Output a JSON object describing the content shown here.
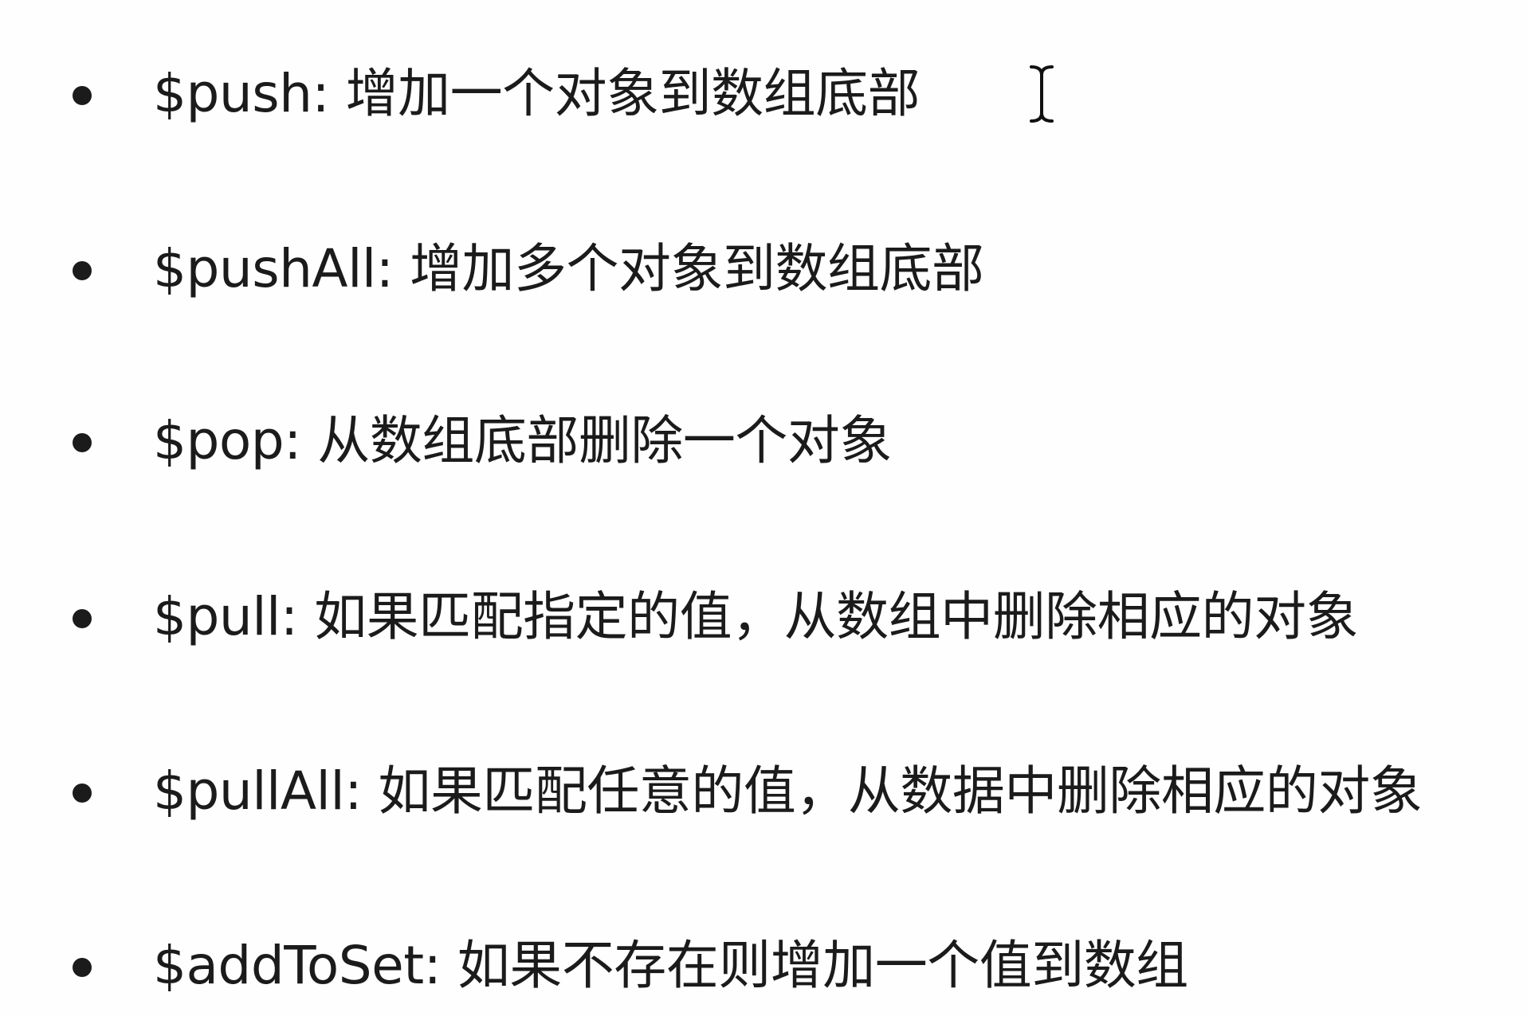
{
  "items": [
    {
      "text": "$push: 增加一个对象到数组底部"
    },
    {
      "text": "$pushAll: 增加多个对象到数组底部"
    },
    {
      "text": "$pop: 从数组底部删除一个对象"
    },
    {
      "text": "$pull: 如果匹配指定的值，从数组中删除相应的对象"
    },
    {
      "text": "$pullAll: 如果匹配任意的值，从数据中删除相应的对象"
    },
    {
      "text": "$addToSet: 如果不存在则增加一个值到数组"
    }
  ],
  "cursor": {
    "icon": "ibeam-cursor-icon"
  }
}
